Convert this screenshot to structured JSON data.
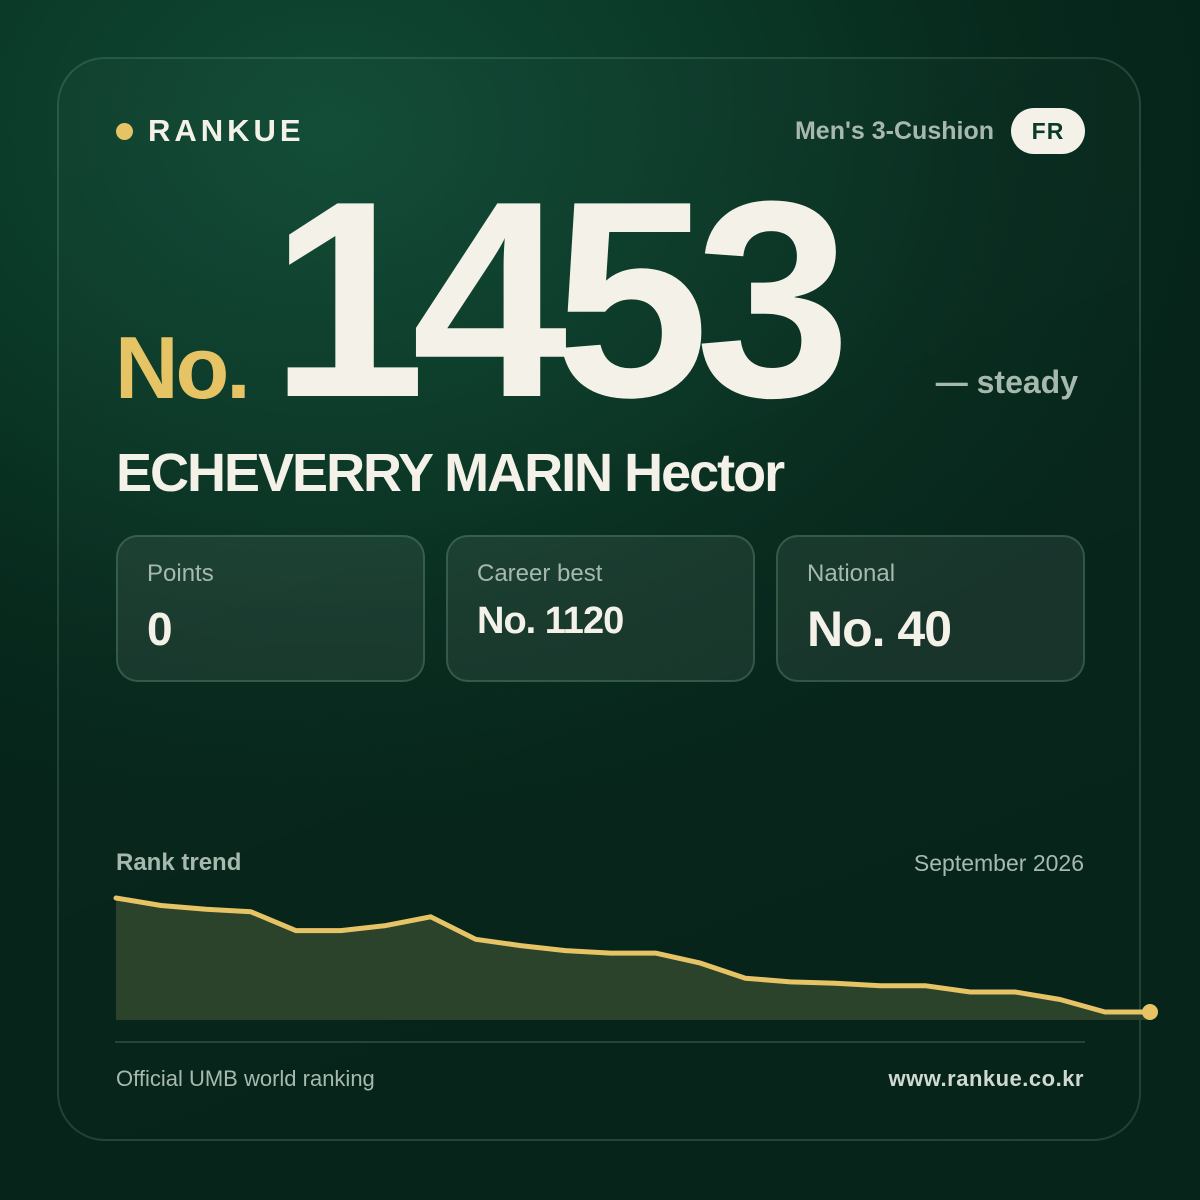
{
  "brand": {
    "name": "RANKUE",
    "accent_color": "#e6c365"
  },
  "category": "Men's 3-Cushion",
  "country_code": "FR",
  "rank": {
    "prefix": "No.",
    "number": "1453",
    "trend": "— steady"
  },
  "player_name": "ECHEVERRY MARIN Hector",
  "stats": [
    {
      "label": "Points",
      "value": "0"
    },
    {
      "label": "Career best",
      "value": "No. 1120"
    },
    {
      "label": "National",
      "value": "No. 40"
    }
  ],
  "chart": {
    "title": "Rank trend",
    "date": "September 2026"
  },
  "chart_data": {
    "type": "area",
    "title": "Rank trend",
    "xlabel": "",
    "ylabel": "",
    "line_color": "#e6c365",
    "fill_color": "#2b422b",
    "values": [
      0,
      6,
      9,
      11,
      26,
      26,
      22,
      15,
      33,
      38,
      42,
      44,
      44,
      52,
      64,
      67,
      68,
      70,
      70,
      75,
      75,
      81,
      91,
      91
    ],
    "note_scale": "relative movement, higher = worse rank"
  },
  "footer": {
    "source": "Official UMB world ranking",
    "url": "www.rankue.co.kr"
  },
  "colors": {
    "background": "#0b3a28",
    "text_primary": "#f4f1e8",
    "text_secondary": "#a7b9ae",
    "accent": "#e6c365"
  }
}
